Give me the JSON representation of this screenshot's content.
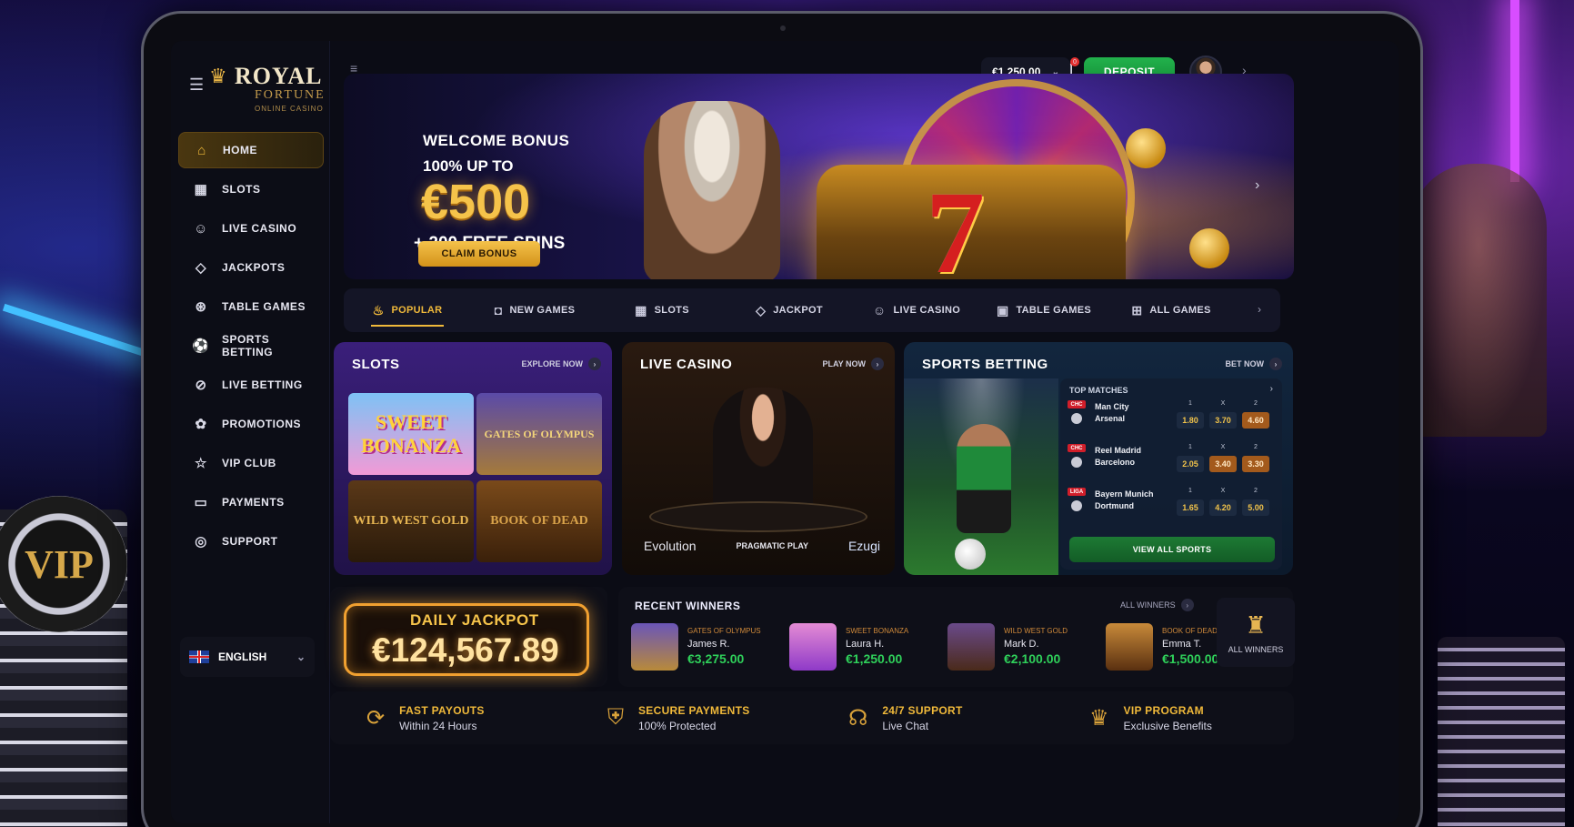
{
  "brand": {
    "name": "ROYAL",
    "line2": "FORTUNE",
    "line3": "ONLINE CASINO"
  },
  "sidebar": {
    "items": [
      {
        "label": "HOME",
        "icon": "home-icon",
        "active": true
      },
      {
        "label": "SLOTS",
        "icon": "slots-icon"
      },
      {
        "label": "LIVE CASINO",
        "icon": "dealer-icon"
      },
      {
        "label": "JACKPOTS",
        "icon": "diamond-icon"
      },
      {
        "label": "TABLE GAMES",
        "icon": "chip-icon"
      },
      {
        "label": "SPORTS BETTING",
        "icon": "ball-icon"
      },
      {
        "label": "LIVE BETTING",
        "icon": "live-icon"
      },
      {
        "label": "PROMOTIONS",
        "icon": "gift-icon"
      },
      {
        "label": "VIP CLUB",
        "icon": "star-icon"
      },
      {
        "label": "PAYMENTS",
        "icon": "wallet-icon"
      },
      {
        "label": "SUPPORT",
        "icon": "support-icon"
      }
    ],
    "language": "ENGLISH"
  },
  "topbar": {
    "balance": "€1,250.00",
    "deposit_label": "DEPOSIT",
    "gift_badge": "0",
    "notif_badge": "0"
  },
  "hero": {
    "title": "WELCOME BONUS",
    "subtitle": "100% UP TO",
    "amount": "€500",
    "spins": "+ 200 FREE SPINS",
    "cta": "CLAIM BONUS"
  },
  "tabs": [
    {
      "label": "POPULAR",
      "icon": "flame-icon",
      "active": true
    },
    {
      "label": "NEW GAMES",
      "icon": "new-icon"
    },
    {
      "label": "SLOTS",
      "icon": "slots-icon"
    },
    {
      "label": "JACKPOT",
      "icon": "diamond-icon"
    },
    {
      "label": "LIVE CASINO",
      "icon": "dealer-icon"
    },
    {
      "label": "TABLE GAMES",
      "icon": "cards-icon"
    },
    {
      "label": "ALL GAMES",
      "icon": "grid-icon"
    }
  ],
  "slots": {
    "title": "SLOTS",
    "link": "EXPLORE NOW",
    "games": [
      "SWEET BONANZA",
      "GATES OF OLYMPUS",
      "WILD WEST GOLD",
      "BOOK OF DEAD"
    ]
  },
  "live": {
    "title": "LIVE CASINO",
    "link": "PLAY NOW",
    "providers": [
      "Evolution",
      "PRAGMATIC PLAY",
      "Ezugi"
    ]
  },
  "sports": {
    "title": "SPORTS BETTING",
    "link": "BET NOW",
    "matches_title": "TOP MATCHES",
    "odds_labels": [
      "1",
      "X",
      "2"
    ],
    "matches": [
      {
        "league": "CHC",
        "home": "Man City",
        "away": "Arsenal",
        "odds": [
          "1.80",
          "3.70",
          "4.60"
        ]
      },
      {
        "league": "CHC",
        "home": "Reel Madrid",
        "away": "Barcelono",
        "odds": [
          "2.05",
          "3.40",
          "3.30"
        ]
      },
      {
        "league": "LIGA",
        "home": "Bayern Munich",
        "away": "Dortmund",
        "odds": [
          "1.65",
          "4.20",
          "5.00"
        ]
      }
    ],
    "view_all": "VIEW ALL SPORTS"
  },
  "jackpot": {
    "label": "DAILY JACKPOT",
    "value": "€124,567.89"
  },
  "winners": {
    "title": "RECENT WINNERS",
    "link": "ALL WINNERS",
    "list": [
      {
        "game": "GATES OF OLYMPUS",
        "name": "James R.",
        "amount": "€3,275.00"
      },
      {
        "game": "SWEET BONANZA",
        "name": "Laura H.",
        "amount": "€1,250.00"
      },
      {
        "game": "WILD WEST GOLD",
        "name": "Mark D.",
        "amount": "€2,100.00"
      },
      {
        "game": "BOOK OF DEAD",
        "name": "Emma T.",
        "amount": "€1,500.00"
      }
    ],
    "all_button": "ALL WINNERS"
  },
  "features": [
    {
      "title": "FAST PAYOUTS",
      "sub": "Within 24 Hours",
      "icon": "payout-icon"
    },
    {
      "title": "SECURE PAYMENTS",
      "sub": "100% Protected",
      "icon": "shield-icon"
    },
    {
      "title": "24/7 SUPPORT",
      "sub": "Live Chat",
      "icon": "headset-icon"
    },
    {
      "title": "VIP PROGRAM",
      "sub": "Exclusive Benefits",
      "icon": "crown-icon"
    }
  ],
  "decor": {
    "vip_chip": "VIP"
  }
}
